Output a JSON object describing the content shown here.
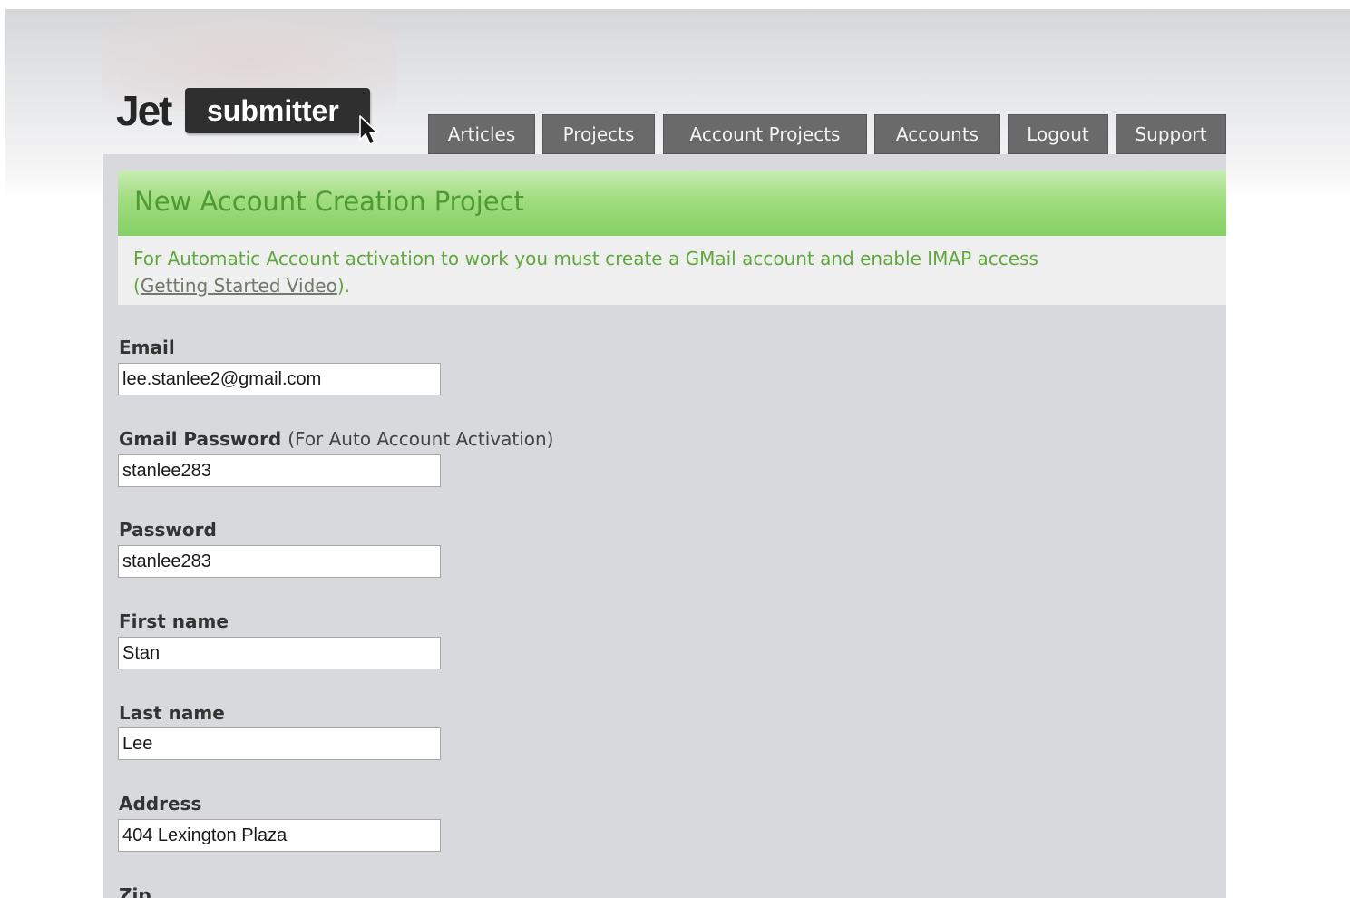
{
  "logo": {
    "part1": "Jet",
    "part2": "submitter"
  },
  "nav": {
    "items": [
      {
        "label": "Articles"
      },
      {
        "label": "Projects"
      },
      {
        "label": "Account Projects"
      },
      {
        "label": "Accounts"
      },
      {
        "label": "Logout"
      },
      {
        "label": "Support"
      }
    ]
  },
  "page": {
    "title": "New Account Creation Project",
    "notice": {
      "text": "For Automatic Account activation to work you must create a GMail account and enable IMAP access",
      "link_open": "(",
      "link": "Getting Started Video",
      "link_close": ")."
    }
  },
  "form": {
    "fields": [
      {
        "label": "Email",
        "note": "",
        "value": "lee.stanlee2@gmail.com"
      },
      {
        "label": "Gmail Password",
        "note": "(For Auto Account Activation)",
        "value": "stanlee283"
      },
      {
        "label": "Password",
        "note": "",
        "value": "stanlee283"
      },
      {
        "label": "First name",
        "note": "",
        "value": "Stan"
      },
      {
        "label": "Last name",
        "note": "",
        "value": "Lee"
      },
      {
        "label": "Address",
        "note": "",
        "value": "404 Lexington Plaza"
      },
      {
        "label": "Zip",
        "note": "",
        "value": ""
      }
    ]
  },
  "colors": {
    "title_bar": "#9fdc7e",
    "title_text": "#4f9a32",
    "notice_text": "#5fa83d",
    "nav_tab": "#6a6a6a",
    "content_bg": "#d8d9dc"
  }
}
